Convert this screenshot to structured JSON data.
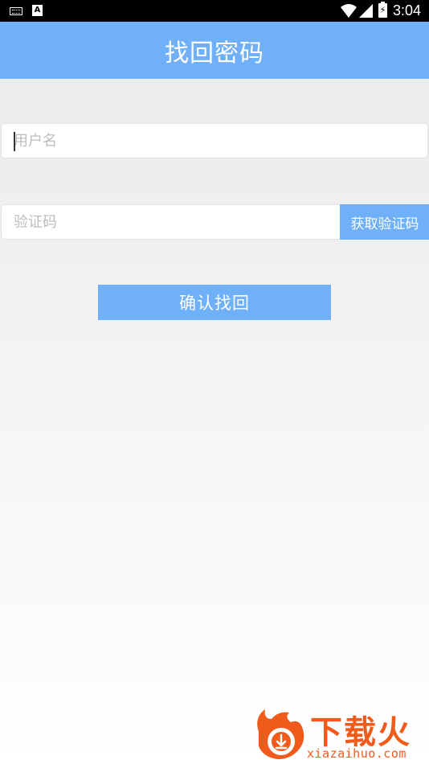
{
  "status_bar": {
    "time": "3:04",
    "battery_label": "⚡",
    "icons": [
      "keyboard-icon",
      "a-notification-icon",
      "wifi-icon",
      "signal-icon",
      "battery-icon"
    ]
  },
  "header": {
    "title": "找回密码"
  },
  "form": {
    "username_placeholder": "用户名",
    "code_placeholder": "验证码",
    "get_code_label": "获取验证码",
    "confirm_label": "确认找回"
  },
  "watermark": {
    "brand": "下载火",
    "url": "xiazaihuo.com"
  },
  "colors": {
    "accent": "#6fb0f8",
    "watermark": "#f05a1a"
  }
}
